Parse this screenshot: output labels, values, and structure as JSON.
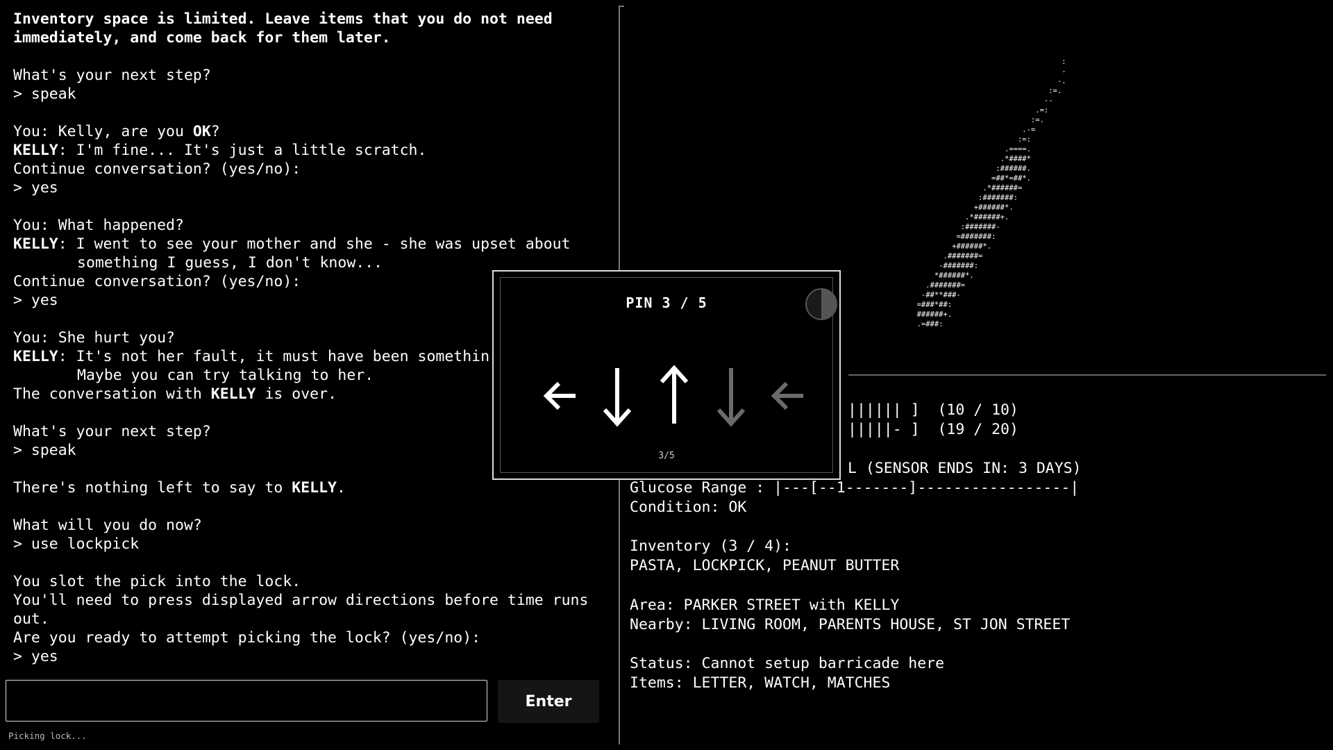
{
  "log": [
    {
      "segments": [
        {
          "t": "Inventory space is limited. Leave items that you do not need",
          "b": true
        }
      ]
    },
    {
      "segments": [
        {
          "t": "immediately, and come back for them later.",
          "b": true
        }
      ]
    },
    {
      "segments": []
    },
    {
      "segments": [
        {
          "t": "What's your next step?"
        }
      ]
    },
    {
      "segments": [
        {
          "t": "> speak"
        }
      ]
    },
    {
      "segments": []
    },
    {
      "segments": [
        {
          "t": "You: Kelly, are you "
        },
        {
          "t": "OK",
          "b": true
        },
        {
          "t": "?"
        }
      ]
    },
    {
      "segments": [
        {
          "t": "KELLY",
          "b": true
        },
        {
          "t": ": I'm fine... It's just a little scratch."
        }
      ]
    },
    {
      "segments": [
        {
          "t": "Continue conversation? (yes/no):"
        }
      ]
    },
    {
      "segments": [
        {
          "t": "> yes"
        }
      ]
    },
    {
      "segments": []
    },
    {
      "segments": [
        {
          "t": "You: What happened?"
        }
      ]
    },
    {
      "segments": [
        {
          "t": "KELLY",
          "b": true
        },
        {
          "t": ": I went to see your mother and she - she was upset about"
        }
      ]
    },
    {
      "segments": [
        {
          "t": "something I guess, I don't know..."
        }
      ],
      "indent": true
    },
    {
      "segments": [
        {
          "t": "Continue conversation? (yes/no):"
        }
      ]
    },
    {
      "segments": [
        {
          "t": "> yes"
        }
      ]
    },
    {
      "segments": []
    },
    {
      "segments": [
        {
          "t": "You: She hurt you?"
        }
      ]
    },
    {
      "segments": [
        {
          "t": "KELLY",
          "b": true
        },
        {
          "t": ": It's not her fault, it must have been somethin"
        }
      ]
    },
    {
      "segments": [
        {
          "t": "Maybe you can try talking to her."
        }
      ],
      "indent": true
    },
    {
      "segments": [
        {
          "t": "The conversation with "
        },
        {
          "t": "KELLY",
          "b": true
        },
        {
          "t": " is over."
        }
      ]
    },
    {
      "segments": []
    },
    {
      "segments": [
        {
          "t": "What's your next step?"
        }
      ]
    },
    {
      "segments": [
        {
          "t": "> speak"
        }
      ]
    },
    {
      "segments": []
    },
    {
      "segments": [
        {
          "t": "There's nothing left to say to "
        },
        {
          "t": "KELLY",
          "b": true
        },
        {
          "t": "."
        }
      ]
    },
    {
      "segments": []
    },
    {
      "segments": [
        {
          "t": "What will you do now?"
        }
      ]
    },
    {
      "segments": [
        {
          "t": "> use lockpick"
        }
      ]
    },
    {
      "segments": []
    },
    {
      "segments": [
        {
          "t": "You slot the pick into the lock."
        }
      ]
    },
    {
      "segments": [
        {
          "t": "You'll need to press displayed arrow directions before time runs"
        }
      ]
    },
    {
      "segments": [
        {
          "t": "out."
        }
      ]
    },
    {
      "segments": [
        {
          "t": "Are you ready to attempt picking the lock? (yes/no):"
        }
      ]
    },
    {
      "segments": [
        {
          "t": "> yes"
        }
      ]
    }
  ],
  "input": {
    "value": "",
    "placeholder": "",
    "enter_label": "Enter"
  },
  "status_line": "Picking lock...",
  "ascii_art": "                                         :\n                                         -\n                                        -.\n                                      :=.\n                                     --\n                                   .=:\n                                  :=.\n                                .-=\n                               :=:\n                            .====.\n                           .*####*\n                          :######.\n                         =##*=##*.\n                       .*######=\n                      :#######:\n                     +######*.\n                   .*######+.\n                  :#######-\n                 =#######:\n                +######*.\n              .#######=\n             -#######:\n            *######*.\n          .#######=\n         -##**###-\n        =###*##:\n        ######+.\n        .=###:",
  "stats": {
    "bar1": "|||||| ]  (10 / 10)",
    "bar2": "|||||- ]  (19 / 20)",
    "sensor": "L (SENSOR ENDS IN: 3 DAYS)",
    "glucose": "Glucose Range : |---[--1-------]-----------------|",
    "condition": "Condition: OK",
    "inventory_title": "Inventory (3 / 4):",
    "inventory_items": "PASTA, LOCKPICK, PEANUT BUTTER",
    "area": "Area: PARKER STREET with KELLY",
    "nearby": "Nearby: LIVING ROOM, PARENTS HOUSE, ST JON STREET",
    "status": "Status: Cannot setup barricade here",
    "items": "Items: LETTER, WATCH, MATCHES"
  },
  "lockpick": {
    "title": "PIN 3 / 5",
    "progress": "3/5",
    "timer_fraction": 0.5,
    "arrows": [
      {
        "dir": "left",
        "state": "done"
      },
      {
        "dir": "down",
        "state": "done"
      },
      {
        "dir": "up",
        "state": "done"
      },
      {
        "dir": "down",
        "state": "pending"
      },
      {
        "dir": "left",
        "state": "pending"
      }
    ],
    "colors": {
      "done": "#ffffff",
      "pending": "#6b6b6b"
    }
  }
}
